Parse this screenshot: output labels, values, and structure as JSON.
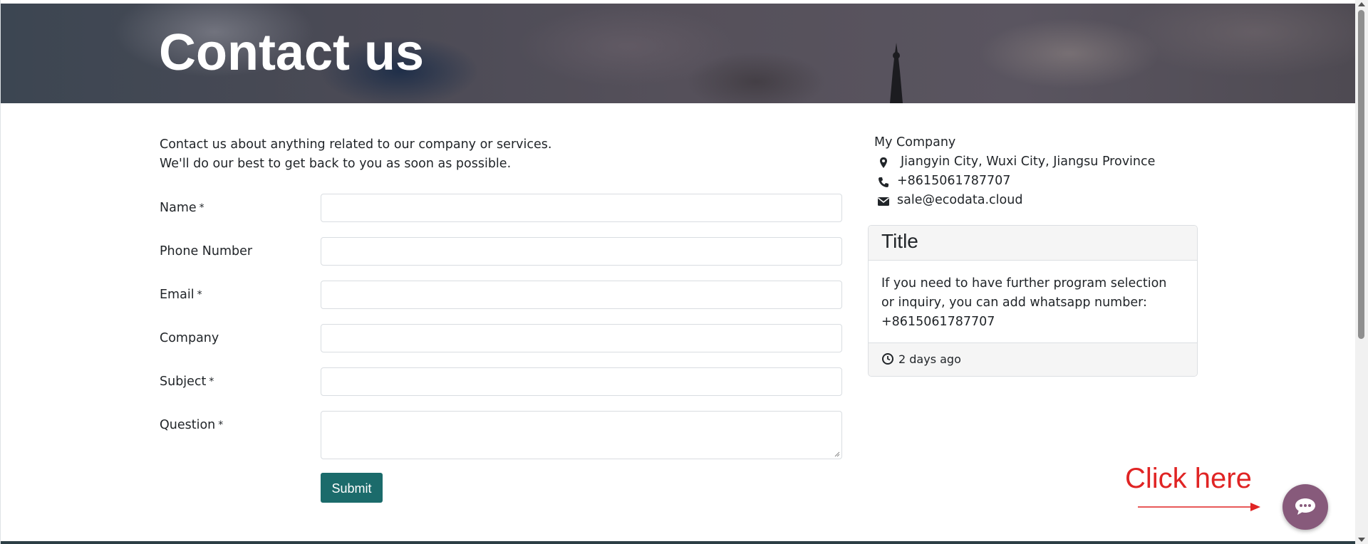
{
  "header": {
    "title": "Contact us"
  },
  "intro": {
    "line1": "Contact us about anything related to our company or services.",
    "line2": "We'll do our best to get back to you as soon as possible."
  },
  "form": {
    "required_mark": "*",
    "fields": [
      {
        "label": "Name",
        "required": true,
        "value": ""
      },
      {
        "label": "Phone Number",
        "required": false,
        "value": ""
      },
      {
        "label": "Email",
        "required": true,
        "value": ""
      },
      {
        "label": "Company",
        "required": false,
        "value": ""
      },
      {
        "label": "Subject",
        "required": true,
        "value": ""
      },
      {
        "label": "Question",
        "required": true,
        "value": ""
      }
    ],
    "submit_label": "Submit"
  },
  "company": {
    "name": "My Company",
    "address": "Jiangyin City, Wuxi City, Jiangsu Province",
    "phone": "+8615061787707",
    "email": "sale@ecodata.cloud"
  },
  "card": {
    "title": "Title",
    "body": "If you need to have further program selection or inquiry, you can add whatsapp number: +8615061787707",
    "timestamp": "2 days ago"
  },
  "annotation": {
    "text": "Click here",
    "color": "#e02424"
  },
  "chat_button": {
    "icon": "chat-icon",
    "color": "#875a7b"
  },
  "colors": {
    "accent": "#1b6b6b",
    "chat": "#875a7b"
  }
}
